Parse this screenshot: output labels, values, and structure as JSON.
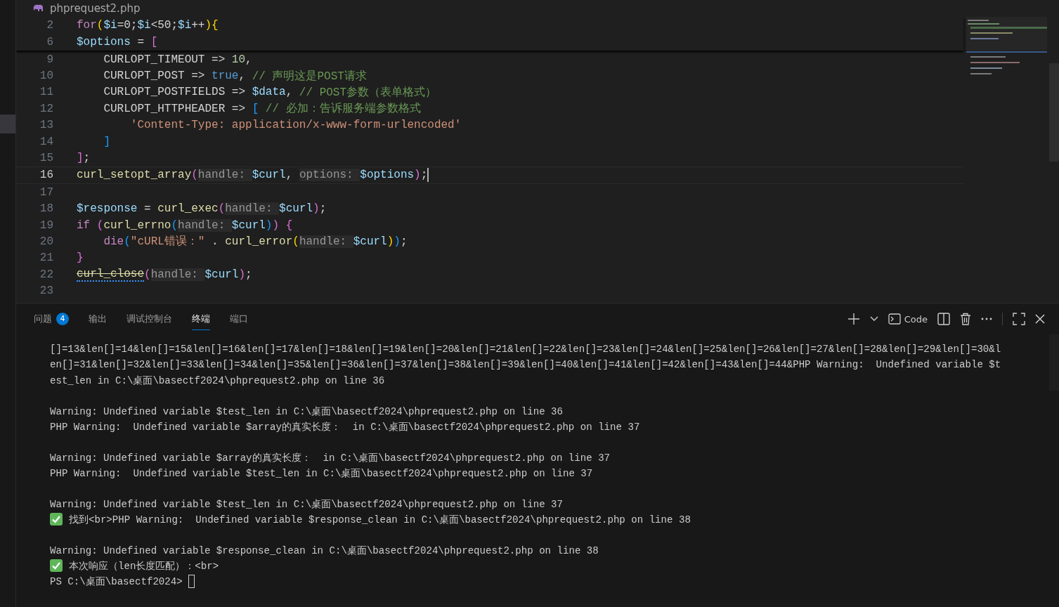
{
  "editor": {
    "file_name": "phprequest2.php",
    "sticky_lines": [
      {
        "number": "2",
        "tokens": [
          {
            "kind": "keyword",
            "text": "for"
          },
          {
            "kind": "bracket1",
            "text": "("
          },
          {
            "kind": "variable",
            "text": "$i"
          },
          {
            "kind": "plain",
            "text": "=0;"
          },
          {
            "kind": "variable",
            "text": "$i"
          },
          {
            "kind": "plain",
            "text": "<50;"
          },
          {
            "kind": "variable",
            "text": "$i"
          },
          {
            "kind": "plain",
            "text": "++"
          },
          {
            "kind": "bracket1",
            "text": "){"
          }
        ]
      },
      {
        "number": "6",
        "tokens": [
          {
            "kind": "variable",
            "text": "$options"
          },
          {
            "kind": "plain",
            "text": " = "
          },
          {
            "kind": "bracket2",
            "text": "["
          }
        ]
      }
    ],
    "lines": [
      {
        "number": "9",
        "current": false,
        "tokens": [
          {
            "kind": "plain",
            "text": "    CURLOPT_TIMEOUT => "
          },
          {
            "kind": "number",
            "text": "10"
          },
          {
            "kind": "plain",
            "text": ","
          }
        ]
      },
      {
        "number": "10",
        "current": false,
        "tokens": [
          {
            "kind": "plain",
            "text": "    CURLOPT_POST => "
          },
          {
            "kind": "constant",
            "text": "true"
          },
          {
            "kind": "plain",
            "text": ", "
          },
          {
            "kind": "comment",
            "text": "// 声明这是POST请求"
          }
        ]
      },
      {
        "number": "11",
        "current": false,
        "tokens": [
          {
            "kind": "plain",
            "text": "    CURLOPT_POSTFIELDS => "
          },
          {
            "kind": "variable",
            "text": "$data"
          },
          {
            "kind": "plain",
            "text": ", "
          },
          {
            "kind": "comment",
            "text": "// POST参数（表单格式）"
          }
        ]
      },
      {
        "number": "12",
        "current": false,
        "tokens": [
          {
            "kind": "plain",
            "text": "    CURLOPT_HTTPHEADER => "
          },
          {
            "kind": "bracket3",
            "text": "["
          },
          {
            "kind": "comment",
            "text": " // 必加：告诉服务端参数格式"
          }
        ]
      },
      {
        "number": "13",
        "current": false,
        "tokens": [
          {
            "kind": "string",
            "text": "        'Content-Type: application/x-www-form-urlencoded'"
          }
        ]
      },
      {
        "number": "14",
        "current": false,
        "tokens": [
          {
            "kind": "bracket3",
            "text": "    ]"
          }
        ]
      },
      {
        "number": "15",
        "current": false,
        "tokens": [
          {
            "kind": "bracket2",
            "text": "]"
          },
          {
            "kind": "plain",
            "text": ";"
          }
        ]
      },
      {
        "number": "16",
        "current": true,
        "tokens": [
          {
            "kind": "function",
            "text": "curl_setopt_array"
          },
          {
            "kind": "bracket2",
            "text": "("
          },
          {
            "kind": "hint",
            "text": "handle:"
          },
          {
            "kind": "variable",
            "text": "$curl"
          },
          {
            "kind": "plain",
            "text": ", "
          },
          {
            "kind": "hint",
            "text": "options:"
          },
          {
            "kind": "variable",
            "text": "$options"
          },
          {
            "kind": "bracket2",
            "text": ")"
          },
          {
            "kind": "plain",
            "text": ";"
          }
        ]
      },
      {
        "number": "17",
        "current": false
      },
      {
        "number": "18",
        "current": false,
        "tokens": [
          {
            "kind": "variable",
            "text": "$response"
          },
          {
            "kind": "plain",
            "text": " = "
          },
          {
            "kind": "function",
            "text": "curl_exec"
          },
          {
            "kind": "bracket2",
            "text": "("
          },
          {
            "kind": "hint",
            "text": "handle:"
          },
          {
            "kind": "variable",
            "text": "$curl"
          },
          {
            "kind": "bracket2",
            "text": ")"
          },
          {
            "kind": "plain",
            "text": ";"
          }
        ]
      },
      {
        "number": "19",
        "current": false,
        "tokens": [
          {
            "kind": "keyword",
            "text": "if"
          },
          {
            "kind": "bracket2",
            "text": " ("
          },
          {
            "kind": "function",
            "text": "curl_errno"
          },
          {
            "kind": "bracket3",
            "text": "("
          },
          {
            "kind": "hint",
            "text": "handle:"
          },
          {
            "kind": "variable",
            "text": "$curl"
          },
          {
            "kind": "bracket3",
            "text": ")"
          },
          {
            "kind": "bracket2",
            "text": ")"
          },
          {
            "kind": "bracket2",
            "text": " {"
          }
        ]
      },
      {
        "number": "20",
        "current": false,
        "tokens": [
          {
            "kind": "keyword",
            "text": "    die"
          },
          {
            "kind": "bracket3",
            "text": "("
          },
          {
            "kind": "string",
            "text": "\"cURL错误：\""
          },
          {
            "kind": "plain",
            "text": " . "
          },
          {
            "kind": "function",
            "text": "curl_error"
          },
          {
            "kind": "bracket1",
            "text": "("
          },
          {
            "kind": "hint",
            "text": "handle:"
          },
          {
            "kind": "variable",
            "text": "$curl"
          },
          {
            "kind": "bracket1",
            "text": ")"
          },
          {
            "kind": "bracket3",
            "text": ")"
          },
          {
            "kind": "plain",
            "text": ";"
          }
        ]
      },
      {
        "number": "21",
        "current": false,
        "tokens": [
          {
            "kind": "bracket2",
            "text": "}"
          }
        ]
      },
      {
        "number": "22",
        "current": false,
        "tokens": [
          {
            "kind": "deprecated",
            "text": "curl_close"
          },
          {
            "kind": "bracket2",
            "text": "("
          },
          {
            "kind": "hint",
            "text": "handle:"
          },
          {
            "kind": "variable",
            "text": "$curl"
          },
          {
            "kind": "bracket2",
            "text": ")"
          },
          {
            "kind": "plain",
            "text": ";"
          }
        ]
      },
      {
        "number": "23",
        "current": false
      }
    ]
  },
  "panel": {
    "tabs": [
      {
        "label": "问题",
        "badge": "4",
        "selected": false
      },
      {
        "label": "输出",
        "selected": false
      },
      {
        "label": "调试控制台",
        "selected": false
      },
      {
        "label": "终端",
        "selected": true
      },
      {
        "label": "端口",
        "selected": false
      }
    ],
    "terminal_name": "Code",
    "terminal_lines": [
      {
        "kind": "text",
        "text": "[]=13&len[]=14&len[]=15&len[]=16&len[]=17&len[]=18&len[]=19&len[]=20&len[]=21&len[]=22&len[]=23&len[]=24&len[]=25&len[]=26&len[]=27&len[]=28&len[]=29&len[]=30&l"
      },
      {
        "kind": "text",
        "text": "en[]=31&len[]=32&len[]=33&len[]=34&len[]=35&len[]=36&len[]=37&len[]=38&len[]=39&len[]=40&len[]=41&len[]=42&len[]=43&len[]=44&PHP Warning:  Undefined variable $t"
      },
      {
        "kind": "text",
        "text": "est_len in C:\\桌面\\basectf2024\\phprequest2.php on line 36"
      },
      {
        "kind": "blank"
      },
      {
        "kind": "text",
        "text": "Warning: Undefined variable $test_len in C:\\桌面\\basectf2024\\phprequest2.php on line 36"
      },
      {
        "kind": "text",
        "text": "PHP Warning:  Undefined variable $array的真实长度：  in C:\\桌面\\basectf2024\\phprequest2.php on line 37"
      },
      {
        "kind": "blank"
      },
      {
        "kind": "text",
        "text": "Warning: Undefined variable $array的真实长度：  in C:\\桌面\\basectf2024\\phprequest2.php on line 37"
      },
      {
        "kind": "text",
        "text": "PHP Warning:  Undefined variable $test_len in C:\\桌面\\basectf2024\\phprequest2.php on line 37"
      },
      {
        "kind": "blank"
      },
      {
        "kind": "text",
        "text": "Warning: Undefined variable $test_len in C:\\桌面\\basectf2024\\phprequest2.php on line 37"
      },
      {
        "kind": "check",
        "text": "找到<br>PHP Warning:  Undefined variable $response_clean in C:\\桌面\\basectf2024\\phprequest2.php on line 38"
      },
      {
        "kind": "blank"
      },
      {
        "kind": "text",
        "text": "Warning: Undefined variable $response_clean in C:\\桌面\\basectf2024\\phprequest2.php on line 38"
      },
      {
        "kind": "check",
        "text": "本次响应（len长度匹配）：<br>"
      },
      {
        "kind": "prompt",
        "text": "PS C:\\桌面\\basectf2024> "
      }
    ]
  }
}
